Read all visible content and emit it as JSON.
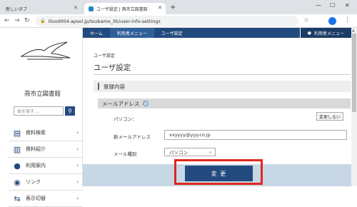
{
  "browser": {
    "tabs": [
      {
        "label": "新しいタブ"
      },
      {
        "label": "ユーザ設定 | 燕市立図書館"
      }
    ],
    "url": "ilisod004.apsel.jp/tsubame_lib/user-info-settings"
  },
  "topnav": {
    "items": [
      "ホーム",
      "利用者メニュー",
      "ユーザ設定"
    ],
    "user_menu": "利用者メニュー"
  },
  "sidebar": {
    "library_name": "燕市立図書館",
    "search_placeholder": "本を探す…",
    "items": [
      {
        "label": "資料検索",
        "icon": "search-book-icon"
      },
      {
        "label": "資料紹介",
        "icon": "book-icon"
      },
      {
        "label": "利用案内",
        "icon": "people-icon"
      },
      {
        "label": "リンク",
        "icon": "user-link-icon"
      },
      {
        "label": "表示切替",
        "icon": "switch-arrows-icon"
      }
    ]
  },
  "main": {
    "breadcrumb": "ユーザ設定",
    "title": "ユーザ設定",
    "section": "登録内容",
    "subsection": "メールアドレス",
    "pc_label": "パソコン：",
    "no_change_button": "変更しない",
    "new_email_label": "新メールアドレス",
    "new_email_value": "xxyyyy@yyy.co.jp",
    "mail_type_label": "メール種別",
    "mail_type_value": "パソコン",
    "submit_button": "変 更"
  },
  "colors": {
    "brand_navy": "#234a7e",
    "highlight_red": "#e0281e",
    "footer_band": "#c8d7e6"
  }
}
